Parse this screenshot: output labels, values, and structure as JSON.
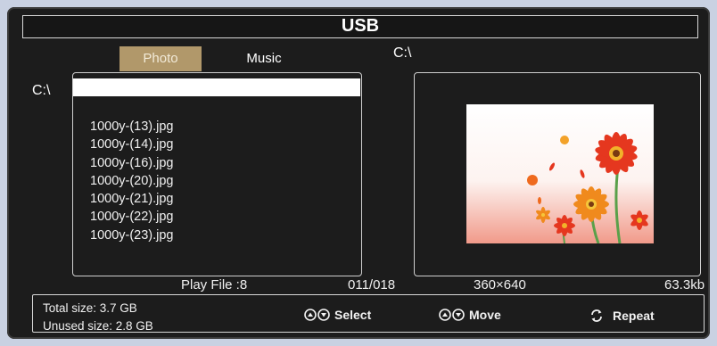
{
  "window": {
    "title": "USB"
  },
  "tabs": {
    "photo": "Photo",
    "music": "Music"
  },
  "paths": {
    "left": "C:\\",
    "right": "C:\\"
  },
  "files": [
    "1000y-(13).jpg",
    "1000y-(14).jpg",
    "1000y-(16).jpg",
    "1000y-(20).jpg",
    "1000y-(21).jpg",
    "1000y-(22).jpg",
    "1000y-(23).jpg"
  ],
  "info": {
    "play_file": "Play File :8",
    "count": "011/018",
    "resolution": "360×640",
    "size": "63.3kb"
  },
  "status": {
    "total": "Total size: 3.7 GB",
    "unused": "Unused size: 2.8 GB",
    "select": "Select",
    "move": "Move",
    "repeat": "Repeat"
  },
  "colors": {
    "background": "#1c1c1c",
    "tab_active": "#b1986a",
    "outer": "#c9d1e2"
  }
}
